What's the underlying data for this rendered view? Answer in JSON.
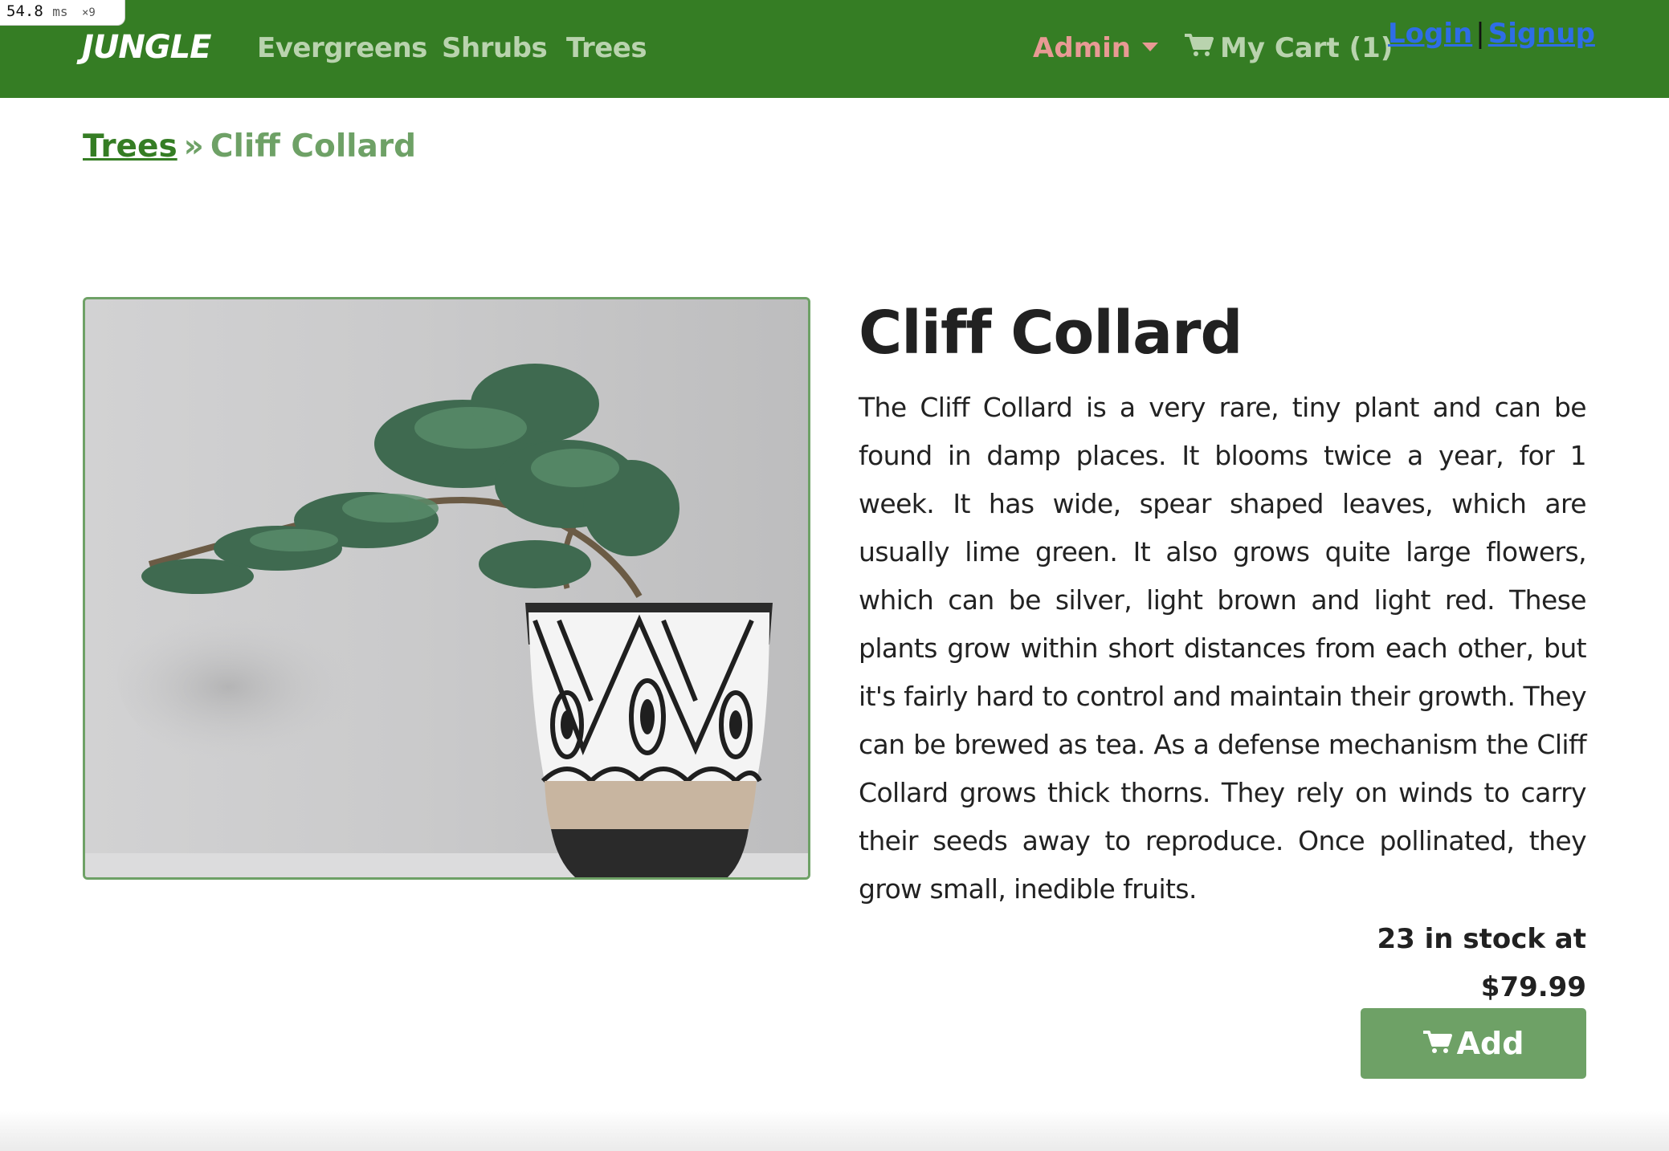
{
  "perf": {
    "value": "54.8",
    "unit": "ms",
    "multiplier": "×9"
  },
  "nav": {
    "brand": "JUNGLE",
    "links": [
      "Evergreens",
      "Shrubs",
      "Trees"
    ],
    "admin_label": "Admin",
    "cart_label": "My Cart (1)",
    "login_label": "Login",
    "auth_separator": "|",
    "signup_label": "Signup",
    "colors": {
      "bar": "#357d24",
      "link": "#b9d3ae",
      "admin": "#e89a94",
      "auth_link": "#2e6de6"
    }
  },
  "breadcrumb": {
    "parent": "Trees",
    "separator": "»",
    "current": "Cliff Collard"
  },
  "product": {
    "name": "Cliff Collard",
    "description": "The Cliff Collard is a very rare, tiny plant and can be found in damp places. It blooms twice a year, for 1 week. It has wide, spear shaped leaves, which are usually lime green. It also grows quite large flowers, which can be silver, light brown and light red. These plants grow within short distances from each other, but it's fairly hard to control and maintain their growth. They can be brewed as tea. As a defense mechanism the Cliff Collard grows thick thorns. They rely on winds to carry their seeds away to reproduce. Once pollinated, they grow small, inedible fruits.",
    "stock_line": "23 in stock at",
    "price": "$79.99",
    "add_label": "Add",
    "image_icon": "bonsai-in-patterned-pot-image",
    "accent_color": "#6ea166"
  }
}
